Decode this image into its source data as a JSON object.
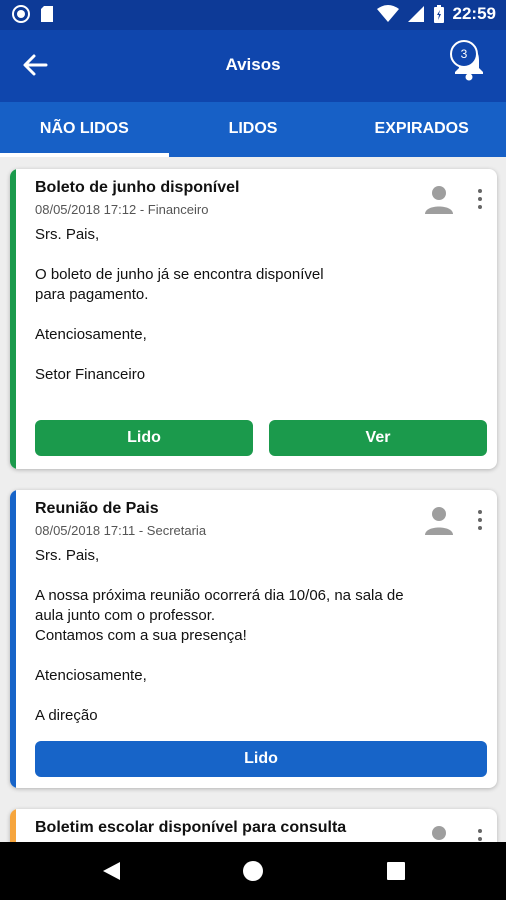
{
  "status_bar": {
    "time": "22:59"
  },
  "app_bar": {
    "title": "Avisos",
    "notification_count": "3"
  },
  "tabs": [
    {
      "label": "NÃO LIDOS",
      "active": true
    },
    {
      "label": "LIDOS",
      "active": false
    },
    {
      "label": "EXPIRADOS",
      "active": false
    }
  ],
  "colors": {
    "green": "#1b9a4c",
    "blue": "#1764c8",
    "orange": "#f6a53d"
  },
  "notices": [
    {
      "title": "Boleto de junho disponível",
      "meta": "08/05/2018 17:12 - Financeiro",
      "paragraphs": [
        "Srs. Pais,",
        "O boleto de junho já se encontra disponível\npara pagamento.",
        "Atenciosamente,",
        "Setor Financeiro"
      ],
      "button_read": "Lido",
      "button_view": "Ver"
    },
    {
      "title": "Reunião de Pais",
      "meta": "08/05/2018 17:11 - Secretaria",
      "paragraphs": [
        "Srs. Pais,",
        "A nossa próxima reunião ocorrerá dia 10/06, na sala de\naula junto com o professor.\nContamos com a sua presença!",
        "Atenciosamente,",
        "A direção"
      ],
      "button_read": "Lido"
    },
    {
      "title": "Boletim escolar disponível para consulta"
    }
  ]
}
